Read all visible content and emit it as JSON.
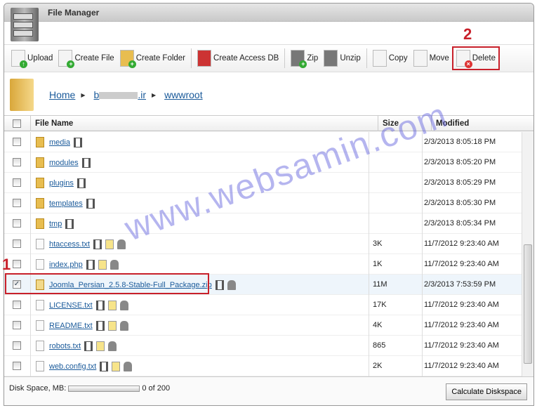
{
  "window": {
    "title": "File Manager"
  },
  "toolbar": [
    {
      "label": "Upload",
      "icon": "upload-icon"
    },
    {
      "label": "Create File",
      "icon": "create-file-icon"
    },
    {
      "label": "Create Folder",
      "icon": "create-folder-icon"
    },
    {
      "label": "Create Access DB",
      "icon": "access-db-icon"
    },
    {
      "label": "Zip",
      "icon": "zip-icon"
    },
    {
      "label": "Unzip",
      "icon": "unzip-icon"
    },
    {
      "label": "Copy",
      "icon": "copy-icon"
    },
    {
      "label": "Move",
      "icon": "move-icon"
    },
    {
      "label": "Delete",
      "icon": "delete-icon"
    }
  ],
  "annotations": {
    "step1": "1",
    "step2": "2"
  },
  "breadcrumb": {
    "home": "Home",
    "domain_visible_start": "b",
    "domain_visible_end": ".ir",
    "folder": "wwwroot"
  },
  "table": {
    "headers": {
      "name": "File Name",
      "size": "Size",
      "modified": "Modified"
    },
    "rows": [
      {
        "name": "media",
        "type": "folder",
        "size": "",
        "modified": "2/3/2013 8:05:18 PM",
        "checked": false
      },
      {
        "name": "modules",
        "type": "folder",
        "size": "",
        "modified": "2/3/2013 8:05:20 PM",
        "checked": false
      },
      {
        "name": "plugins",
        "type": "folder",
        "size": "",
        "modified": "2/3/2013 8:05:29 PM",
        "checked": false
      },
      {
        "name": "templates",
        "type": "folder",
        "size": "",
        "modified": "2/3/2013 8:05:30 PM",
        "checked": false
      },
      {
        "name": "tmp",
        "type": "folder",
        "size": "",
        "modified": "2/3/2013 8:05:34 PM",
        "checked": false
      },
      {
        "name": "htaccess.txt",
        "type": "file",
        "size": "3K",
        "modified": "11/7/2012 9:23:40 AM",
        "checked": false
      },
      {
        "name": "index.php",
        "type": "file",
        "size": "1K",
        "modified": "11/7/2012 9:23:40 AM",
        "checked": false
      },
      {
        "name": "Joomla_Persian_2.5.8-Stable-Full_Package.zip",
        "type": "zip",
        "size": "11M",
        "modified": "2/3/2013 7:53:59 PM",
        "checked": true
      },
      {
        "name": "LICENSE.txt",
        "type": "file",
        "size": "17K",
        "modified": "11/7/2012 9:23:40 AM",
        "checked": false
      },
      {
        "name": "README.txt",
        "type": "file",
        "size": "4K",
        "modified": "11/7/2012 9:23:40 AM",
        "checked": false
      },
      {
        "name": "robots.txt",
        "type": "file",
        "size": "865",
        "modified": "11/7/2012 9:23:40 AM",
        "checked": false
      },
      {
        "name": "web.config.txt",
        "type": "file",
        "size": "2K",
        "modified": "11/7/2012 9:23:40 AM",
        "checked": false
      }
    ]
  },
  "footer": {
    "disk_label": "Disk Space, MB:",
    "disk_usage": "0 of 200",
    "disk_fraction": 0,
    "calc_button": "Calculate Diskspace"
  },
  "watermark": "www.websamin.com",
  "colors": {
    "highlight": "#c8202a",
    "link": "#1a5a9a",
    "selected_row": "#eef5fb"
  }
}
